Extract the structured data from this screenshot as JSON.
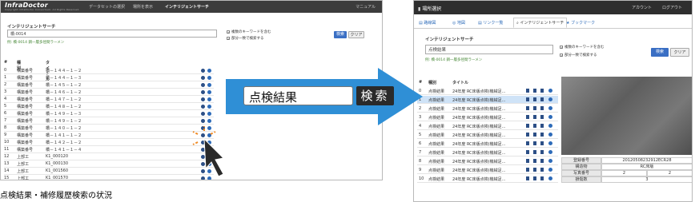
{
  "left": {
    "app_name": "InfraDoctor",
    "app_copyright": "Copyright InfraDoctor Consortium. All Rights Reserved.",
    "nav": [
      "データセットの選択",
      "場所を表示",
      "インテリジェントサーチ"
    ],
    "manual": "マニュアル",
    "search_title": "インテリジェントサーチ",
    "search_value": "橋-0014",
    "search_hint": "例: 橋-0014 鋼一層多径間ラーメン",
    "options": [
      "複数のキーワードを含む",
      "部分一致で検索する"
    ],
    "search_btn": "検索",
    "clear_btn": "クリア",
    "columns": [
      "#",
      "種別",
      "タイトル"
    ],
    "rows": [
      [
        "0",
        "構築番号",
        "橋－１４４－１－２"
      ],
      [
        "1",
        "構築番号",
        "橋－１４４－１－３"
      ],
      [
        "2",
        "構築番号",
        "橋－１４５－１－２"
      ],
      [
        "3",
        "構築番号",
        "橋－１４６－１－２"
      ],
      [
        "4",
        "構築番号",
        "橋－１４７－１－２"
      ],
      [
        "5",
        "構築番号",
        "橋－１４８－１－２"
      ],
      [
        "6",
        "構築番号",
        "橋－１４９－１－３"
      ],
      [
        "7",
        "構築番号",
        "橋－１４９－１－２"
      ],
      [
        "8",
        "構築番号",
        "橋－１４０－１－２"
      ],
      [
        "9",
        "構築番号",
        "橋－１４１－１－２"
      ],
      [
        "10",
        "構築番号",
        "橋－１４２－１－２"
      ],
      [
        "11",
        "構築番号",
        "橋－１４１－１－４"
      ],
      [
        "12",
        "上部工",
        "K1_000120"
      ],
      [
        "13",
        "上部工",
        "K1_000130"
      ],
      [
        "14",
        "上部工",
        "K1_001560"
      ],
      [
        "15",
        "上部工",
        "K1_001570"
      ]
    ]
  },
  "right": {
    "top_title": "場所選択",
    "top_links": [
      "アカウント",
      "ログアウト"
    ],
    "tabs": [
      "路線図",
      "地図",
      "リンク一覧",
      "インテリジェントサーチ",
      "ブックマーク"
    ],
    "search_title": "インテリジェントサーチ",
    "search_value": "点検結果",
    "search_hint": "例: 橋-0014 鋼一層多径間ラーメン",
    "options": [
      "複数のキーワードを含む",
      "部分一致で検索する"
    ],
    "search_btn": "検索",
    "clear_btn": "クリア",
    "columns": [
      "#",
      "種別",
      "タイトル"
    ],
    "rows": [
      [
        "0",
        "点検結果",
        "24年度 RC床版点検(機械足..."
      ],
      [
        "1",
        "点検結果",
        "24年度 RC床版点検(機械足..."
      ],
      [
        "2",
        "点検結果",
        "24年度 RC床版点検(機械足..."
      ],
      [
        "3",
        "点検結果",
        "24年度 RC床版点検(機械足..."
      ],
      [
        "4",
        "点検結果",
        "24年度 RC床版点検(機械足..."
      ],
      [
        "5",
        "点検結果",
        "24年度 RC床版点検(機械足..."
      ],
      [
        "6",
        "点検結果",
        "24年度 RC床版点検(機械足..."
      ],
      [
        "7",
        "点検結果",
        "24年度 RC床版点検(機械足..."
      ],
      [
        "8",
        "点検結果",
        "24年度 RC床版点検(機械足..."
      ],
      [
        "9",
        "点検結果",
        "24年度 RC床版点検(機械足..."
      ],
      [
        "10",
        "点検結果",
        "24年度 RC床版点検(機械足..."
      ]
    ],
    "info": [
      {
        "k": "登録番号",
        "v": "20120508232912ECR28"
      },
      {
        "k": "構造物",
        "v": "RC床版"
      },
      {
        "k": "写真番号",
        "v1": "2",
        "v2": "2"
      },
      {
        "k": "損傷数",
        "v": "3"
      }
    ]
  },
  "overlay": {
    "search_text": "点検結果",
    "search_btn": "検索"
  },
  "caption": "点検結果・補修履歴検索の状況",
  "colors": {
    "accent": "#2d6bb9",
    "arrow": "#2f8fd6",
    "nav_dark": "#3c3c3c"
  }
}
